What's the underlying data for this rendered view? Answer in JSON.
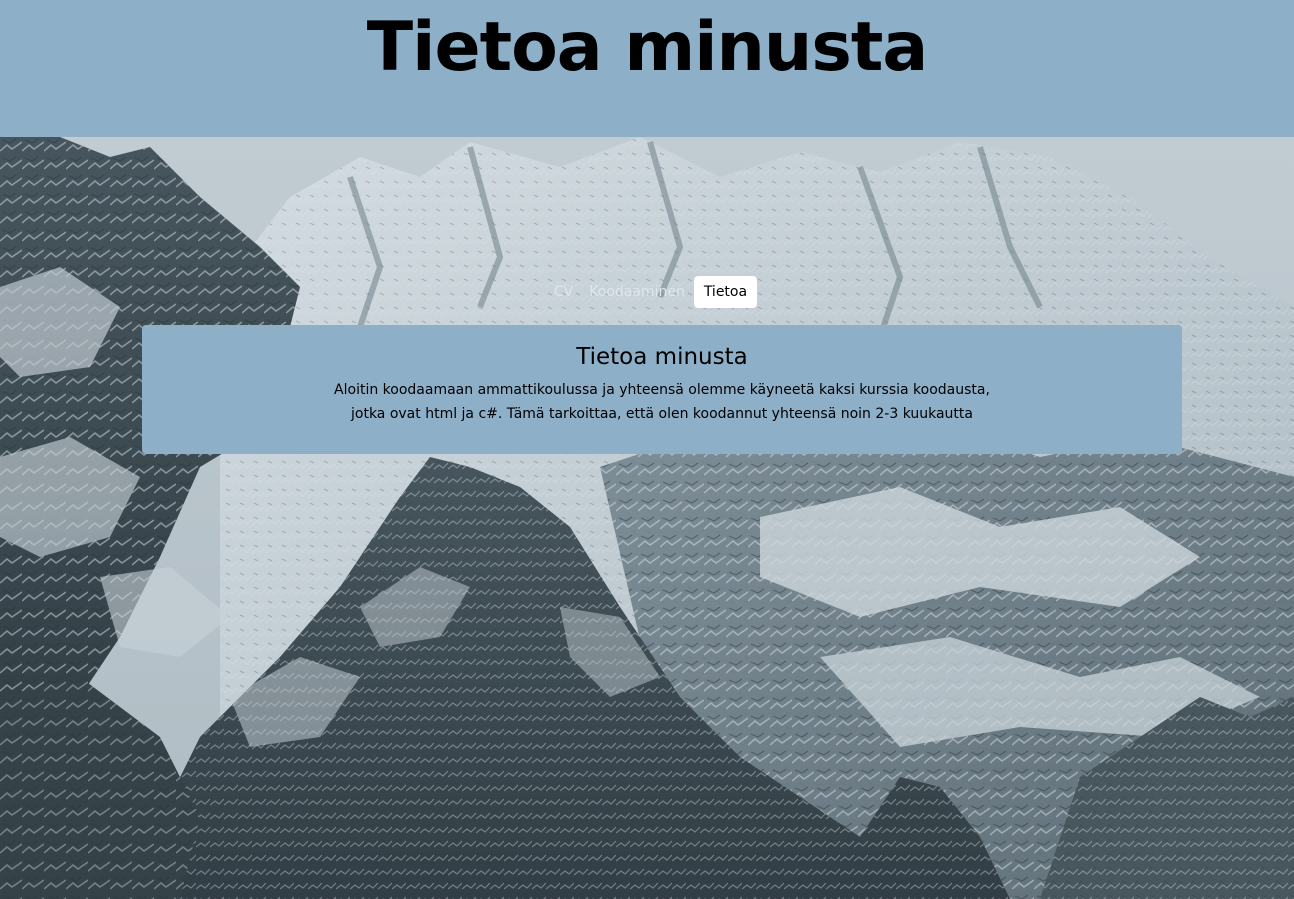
{
  "header": {
    "title": "Tietoa minusta"
  },
  "nav": {
    "items": [
      {
        "label": "CV",
        "active": false
      },
      {
        "label": "Koodaaminen",
        "active": false
      },
      {
        "label": "Tietoa",
        "active": true
      }
    ]
  },
  "card": {
    "title": "Tietoa minusta",
    "text": "Aloitin koodaamaan ammattikoulussa ja yhteensä olemme käyneetä kaksi kurssia koodausta, jotka ovat html ja c#. Tämä tarkoittaa, että olen koodannut yhteensä noin 2-3 kuukautta"
  },
  "colors": {
    "header_bg": "#8eafc8",
    "card_bg": "#8eafc8",
    "nav_active_bg": "#ffffff"
  }
}
